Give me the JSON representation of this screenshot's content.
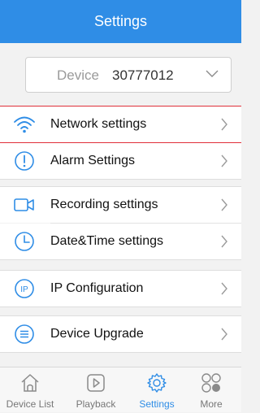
{
  "header": {
    "title": "Settings"
  },
  "device": {
    "label": "Device",
    "value": "30777012"
  },
  "settings_items": [
    {
      "label": "Network settings",
      "icon": "wifi-icon"
    },
    {
      "label": "Alarm Settings",
      "icon": "alert-icon"
    },
    {
      "label": "Recording settings",
      "icon": "video-camera-icon"
    },
    {
      "label": "Date&Time settings",
      "icon": "clock-icon"
    },
    {
      "label": "IP Configuration",
      "icon": "ip-icon"
    },
    {
      "label": "Device Upgrade",
      "icon": "upgrade-icon"
    }
  ],
  "tabbar": {
    "items": [
      {
        "label": "Device List",
        "icon": "home-icon",
        "active": false
      },
      {
        "label": "Playback",
        "icon": "play-icon",
        "active": false
      },
      {
        "label": "Settings",
        "icon": "gear-icon",
        "active": true
      },
      {
        "label": "More",
        "icon": "more-icon",
        "active": false
      }
    ]
  },
  "colors": {
    "accent": "#2f8de6",
    "highlight": "#e0303a",
    "background": "#f2f2f2"
  }
}
